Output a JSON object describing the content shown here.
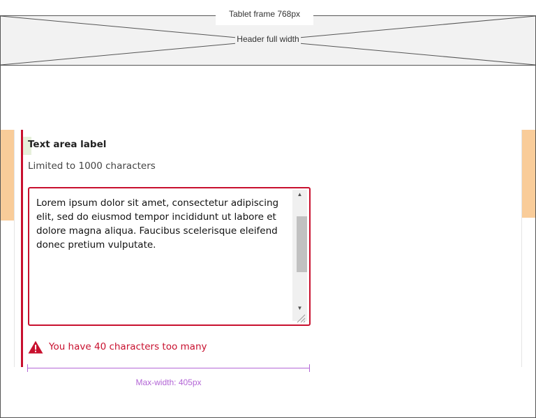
{
  "annotations": {
    "frame_label": "Tablet frame 768px",
    "header_label": "Header full width",
    "max_width_label": "Max-width: 405px"
  },
  "field": {
    "label": "Text area label",
    "hint": "Limited to 1000 characters",
    "value": "Lorem ipsum dolor sit amet, consectetur adipiscing elit, sed do eiusmod tempor incididunt ut labore et dolore magna aliqua. Faucibus scelerisque eleifend donec pretium vulputate.",
    "error_message": "You have 40 characters too many",
    "error_icon": "warning-triangle-icon"
  },
  "colors": {
    "error": "#c8102e",
    "margin_highlight": "#f9cc99",
    "annotation": "#b366d6",
    "header_placeholder": "#f2f2f2"
  }
}
